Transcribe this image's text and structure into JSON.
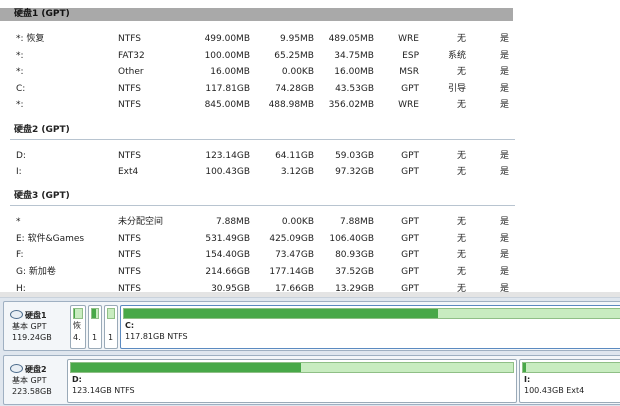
{
  "disks": [
    {
      "header": "硬盘1 (GPT)",
      "rows": [
        {
          "name": "*: 恢复",
          "fs": "NTFS",
          "capacity": "499.00MB",
          "used": "9.95MB",
          "free": "489.05MB",
          "id": "WRE",
          "status": "无",
          "hidden": "是"
        },
        {
          "name": "*:",
          "fs": "FAT32",
          "capacity": "100.00MB",
          "used": "65.25MB",
          "free": "34.75MB",
          "id": "ESP",
          "status": "系统",
          "hidden": "是"
        },
        {
          "name": "*:",
          "fs": "Other",
          "capacity": "16.00MB",
          "used": "0.00KB",
          "free": "16.00MB",
          "id": "MSR",
          "status": "无",
          "hidden": "是"
        },
        {
          "name": "C:",
          "fs": "NTFS",
          "capacity": "117.81GB",
          "used": "74.28GB",
          "free": "43.53GB",
          "id": "GPT",
          "status": "引导",
          "hidden": "是"
        },
        {
          "name": "*:",
          "fs": "NTFS",
          "capacity": "845.00MB",
          "used": "488.98MB",
          "free": "356.02MB",
          "id": "WRE",
          "status": "无",
          "hidden": "是"
        }
      ]
    },
    {
      "header": "硬盘2 (GPT)",
      "rows": [
        {
          "name": "D:",
          "fs": "NTFS",
          "capacity": "123.14GB",
          "used": "64.11GB",
          "free": "59.03GB",
          "id": "GPT",
          "status": "无",
          "hidden": "是"
        },
        {
          "name": "I:",
          "fs": "Ext4",
          "capacity": "100.43GB",
          "used": "3.12GB",
          "free": "97.32GB",
          "id": "GPT",
          "status": "无",
          "hidden": "是"
        }
      ]
    },
    {
      "header": "硬盘3 (GPT)",
      "rows": [
        {
          "name": "*",
          "fs": "未分配空间",
          "capacity": "7.88MB",
          "used": "0.00KB",
          "free": "7.88MB",
          "id": "GPT",
          "status": "无",
          "hidden": "是"
        },
        {
          "name": "E: 软件&Games",
          "fs": "NTFS",
          "capacity": "531.49GB",
          "used": "425.09GB",
          "free": "106.40GB",
          "id": "GPT",
          "status": "无",
          "hidden": "是"
        },
        {
          "name": "F:",
          "fs": "NTFS",
          "capacity": "154.40GB",
          "used": "73.47GB",
          "free": "80.93GB",
          "id": "GPT",
          "status": "无",
          "hidden": "是"
        },
        {
          "name": "G: 新加卷",
          "fs": "NTFS",
          "capacity": "214.66GB",
          "used": "177.14GB",
          "free": "37.52GB",
          "id": "GPT",
          "status": "无",
          "hidden": "是"
        },
        {
          "name": "H:",
          "fs": "NTFS",
          "capacity": "30.95GB",
          "used": "17.66GB",
          "free": "13.29GB",
          "id": "GPT",
          "status": "无",
          "hidden": "是"
        }
      ]
    }
  ],
  "map": [
    {
      "name": "硬盘1",
      "type": "基本 GPT",
      "size": "119.24GB",
      "parts": [
        {
          "label": "恢",
          "size": "4.",
          "used_fraction": 0.02
        },
        {
          "label": "",
          "size": "1",
          "used_fraction": 0.65
        },
        {
          "label": "",
          "size": "1",
          "used_fraction": 0.0
        },
        {
          "label": "C:",
          "size": "117.81GB NTFS",
          "used_fraction": 0.63
        }
      ]
    },
    {
      "name": "硬盘2",
      "type": "基本 GPT",
      "size": "223.58GB",
      "parts": [
        {
          "label": "D:",
          "size": "123.14GB NTFS",
          "used_fraction": 0.52
        },
        {
          "label": "I:",
          "size": "100.43GB Ext4",
          "used_fraction": 0.03
        }
      ]
    }
  ]
}
